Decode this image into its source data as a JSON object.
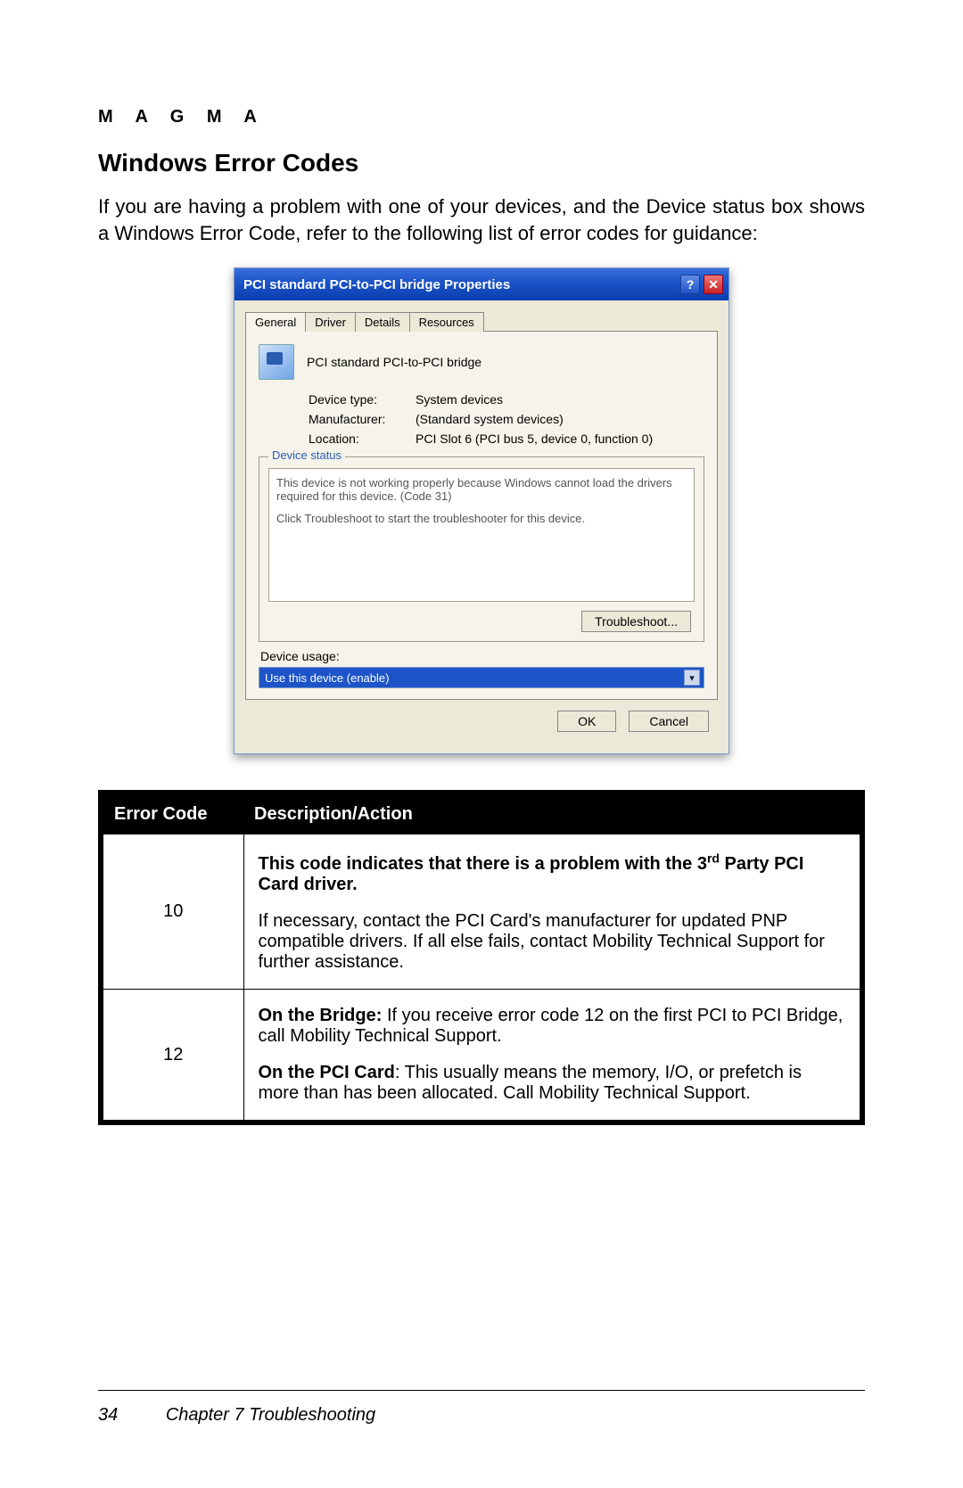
{
  "brand": "M A G M A",
  "section_title": "Windows Error Codes",
  "intro": "If you are having a problem with one of your devices, and the Device status box shows a Windows Error Code, refer to the following list of error codes for guidance:",
  "dialog": {
    "title": "PCI standard PCI-to-PCI bridge Properties",
    "help_glyph": "?",
    "close_glyph": "✕",
    "tabs": [
      "General",
      "Driver",
      "Details",
      "Resources"
    ],
    "device_name": "PCI standard PCI-to-PCI bridge",
    "info": {
      "type_lbl": "Device type:",
      "type_val": "System devices",
      "mfr_lbl": "Manufacturer:",
      "mfr_val": "(Standard system devices)",
      "loc_lbl": "Location:",
      "loc_val": "PCI Slot 6 (PCI bus 5, device 0, function 0)"
    },
    "status_legend": "Device status",
    "status_line1": "This device is not working properly because Windows cannot load the drivers required for this device. (Code 31)",
    "status_line2": "Click Troubleshoot to start the troubleshooter for this device.",
    "troubleshoot_btn": "Troubleshoot...",
    "usage_label": "Device usage:",
    "usage_value": "Use this device (enable)",
    "ok": "OK",
    "cancel": "Cancel"
  },
  "table": {
    "h1": "Error Code",
    "h2": "Description/Action",
    "rows": [
      {
        "code": "10",
        "bold": "This code indicates that there is a problem with the 3",
        "bold_sup": "rd",
        "bold_tail": " Party PCI Card driver.",
        "body": "If necessary, contact the PCI Card's manufacturer for updated PNP compatible drivers. If all else fails, contact Mobility Technical Support for further assistance."
      },
      {
        "code": "12",
        "p1_lead": "On the Bridge:",
        "p1": " If you receive error code 12 on the first PCI to PCI Bridge, call Mobility Technical Support.",
        "p2_lead": "On the PCI Card",
        "p2": ": This usually means the memory, I/O, or prefetch is more than has been allocated. Call Mobility Technical Support."
      }
    ]
  },
  "footer": {
    "page": "34",
    "chapter": "Chapter 7    Troubleshooting"
  }
}
